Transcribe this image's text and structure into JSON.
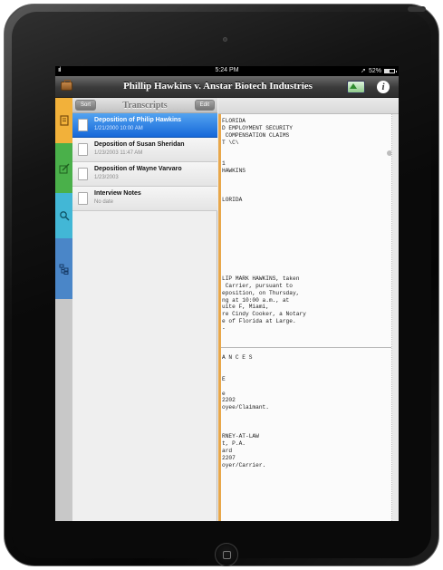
{
  "status_bar": {
    "signal": "ııl",
    "time": "5:24 PM",
    "battery_pct": "52%"
  },
  "nav": {
    "title": "Phillip Hawkins v. Anstar Biotech Industries",
    "left_icon": "briefcase-icon",
    "monitor_icon": "monitor-icon",
    "info_label": "i"
  },
  "sidebar_tabs": [
    {
      "name": "transcripts",
      "icon": "document-icon",
      "color": "#f2b13a"
    },
    {
      "name": "annotations",
      "icon": "pencil-icon",
      "color": "#4ab04a"
    },
    {
      "name": "search",
      "icon": "search-icon",
      "color": "#42b7d6"
    },
    {
      "name": "outline",
      "icon": "tree-icon",
      "color": "#4a86c8"
    }
  ],
  "panel": {
    "title": "Transcripts",
    "sort_label": "Sort",
    "edit_label": "Edit",
    "items": [
      {
        "title": "Deposition of Philip Hawkins",
        "subtitle": "1/21/2000 10:00 AM",
        "selected": true
      },
      {
        "title": "Deposition of Susan Sheridan",
        "subtitle": "1/23/2003 11:47 AM",
        "selected": false
      },
      {
        "title": "Deposition of Wayne Varvaro",
        "subtitle": "1/23/2003",
        "selected": false
      },
      {
        "title": "Interview Notes",
        "subtitle": "No date",
        "selected": false
      }
    ]
  },
  "document": {
    "page1_lines": [
      "FLORIDA",
      "D EMPLOYMENT SECURITY",
      " COMPENSATION CLAIMS",
      "T \\C\\",
      "",
      "",
      "1",
      "HAWKINS",
      "",
      "",
      "",
      "LORIDA",
      "",
      "",
      "",
      "",
      "",
      "",
      "",
      "",
      "",
      "",
      "LIP MARK HAWKINS, taken",
      " Carrier, pursuant to",
      "eposition, on Thursday,",
      "ng at 10:00 a.m., at",
      "uite F, Miami,",
      "re Cindy Cooker, a Notary",
      "e of Florida at Large.",
      "-"
    ],
    "page2_lines": [
      "A N C E S",
      "",
      "",
      "E",
      "",
      "e",
      "2202",
      "oyee/Claimant.",
      "",
      "",
      "",
      "RNEY-AT-LAW",
      "t, P.A.",
      "ard",
      "2207",
      "oyer/Carrier."
    ]
  }
}
